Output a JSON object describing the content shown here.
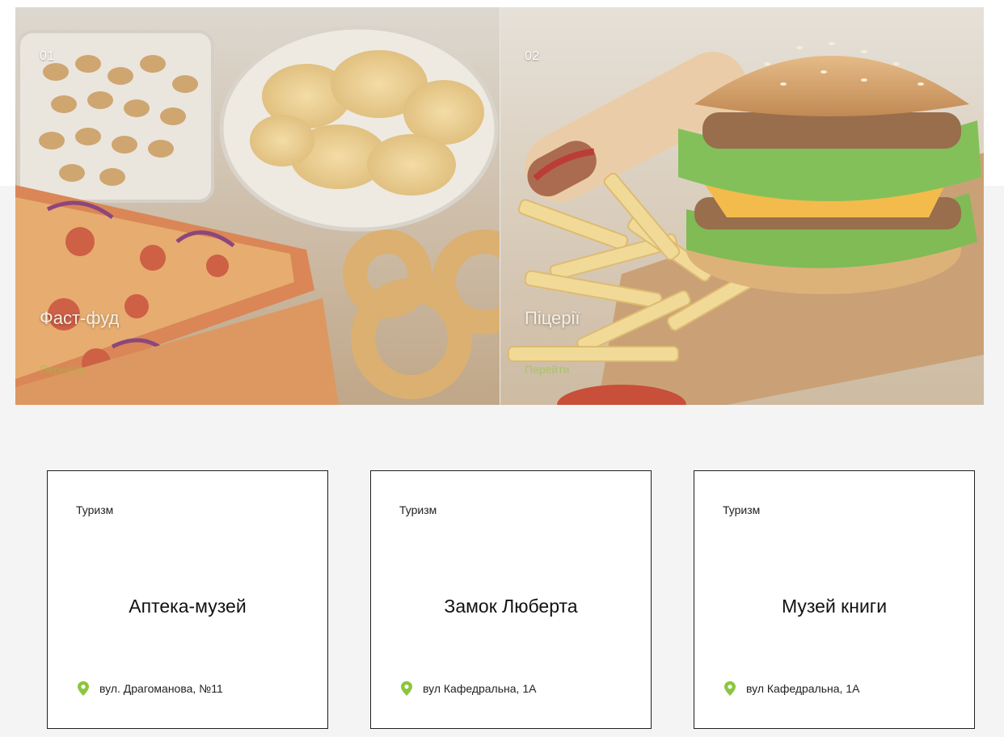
{
  "theme": {
    "accent": "#8cc63f",
    "card_border": "#1f1f1f",
    "background": "#f3f4f3"
  },
  "hero": {
    "tiles": [
      {
        "number": "01",
        "title": "Фаст-фуд",
        "link": "Перейти"
      },
      {
        "number": "02",
        "title": "Піцерії",
        "link": "Перейти"
      }
    ]
  },
  "cards": [
    {
      "category": "Туризм",
      "name": "Аптека-музей",
      "address": "вул. Драгоманова, №11",
      "icon": "map-pin-icon"
    },
    {
      "category": "Туризм",
      "name": "Замок Люберта",
      "address": "вул Кафедральна, 1А",
      "icon": "map-pin-icon"
    },
    {
      "category": "Туризм",
      "name": "Музей книги",
      "address": "вул Кафедральна, 1А",
      "icon": "map-pin-icon"
    }
  ]
}
